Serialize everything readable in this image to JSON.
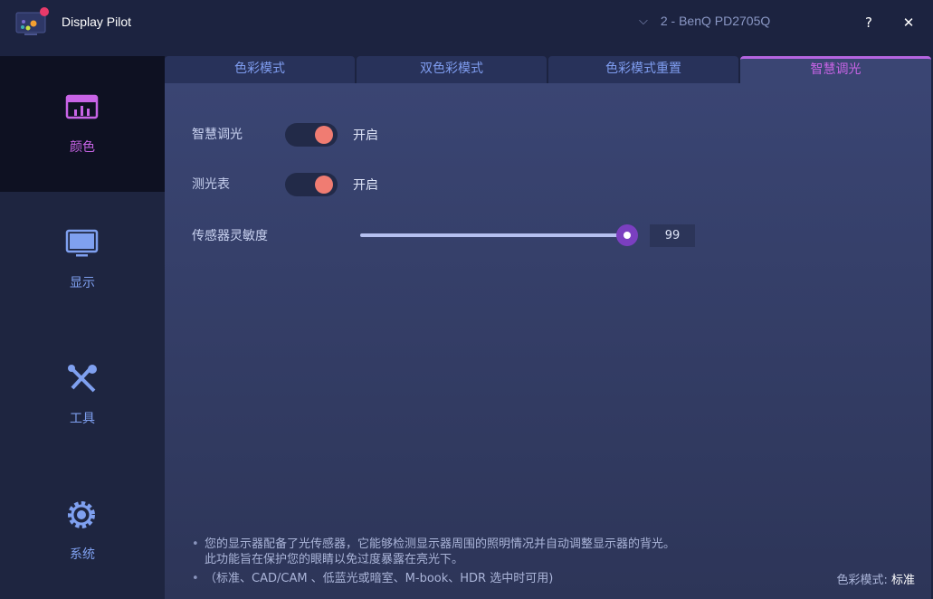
{
  "app": {
    "title": "Display Pilot",
    "monitor": "2 - BenQ PD2705Q",
    "help": "?",
    "close": "✕"
  },
  "sidebar": {
    "items": [
      {
        "label": "颜色",
        "icon": "color-icon"
      },
      {
        "label": "显示",
        "icon": "monitor-icon"
      },
      {
        "label": "工具",
        "icon": "tools-icon"
      },
      {
        "label": "系统",
        "icon": "gear-icon"
      }
    ]
  },
  "tabs": [
    "色彩模式",
    "双色彩模式",
    "色彩模式重置",
    "智慧调光"
  ],
  "settings": {
    "smart_dimming": {
      "label": "智慧调光",
      "state": "开启"
    },
    "light_meter": {
      "label": "测光表",
      "state": "开启"
    },
    "sensitivity": {
      "label": "传感器灵敏度",
      "value": "99",
      "percent": 99
    }
  },
  "notes": {
    "line1": "您的显示器配备了光传感器，它能够检测显示器周围的照明情况并自动调整显示器的背光。",
    "line2": "此功能旨在保护您的眼睛以免过度暴露在亮光下。",
    "line3": "（标准、CAD/CAM 、低蓝光或暗室、M-book、HDR 选中时可用)",
    "bullet": "•"
  },
  "footer": {
    "mode_label": "色彩模式:",
    "mode_value": "标准"
  },
  "colors": {
    "accent": "#c864e6",
    "toggle_on": "#f07c72"
  }
}
